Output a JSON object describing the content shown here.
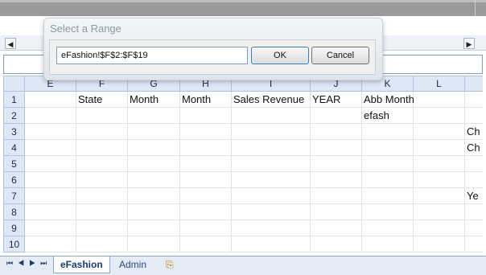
{
  "dialog": {
    "title": "Select a Range",
    "range_value": "eFashion!$F$2:$F$19",
    "ok_label": "OK",
    "cancel_label": "Cancel"
  },
  "grid": {
    "columns": [
      "E",
      "F",
      "G",
      "H",
      "I",
      "J",
      "K",
      "L"
    ],
    "rows": [
      {
        "num": "1",
        "cells": [
          "",
          "State",
          "Month",
          "Month",
          "Sales Revenue",
          "YEAR",
          "Abb Month",
          "",
          ""
        ]
      },
      {
        "num": "2",
        "cells": [
          "",
          "",
          "",
          "",
          "",
          "",
          "efash",
          "",
          ""
        ]
      },
      {
        "num": "3",
        "cells": [
          "",
          "",
          "",
          "",
          "",
          "",
          "",
          "",
          "Ch"
        ]
      },
      {
        "num": "4",
        "cells": [
          "",
          "",
          "",
          "",
          "",
          "",
          "",
          "",
          "Ch"
        ]
      },
      {
        "num": "5",
        "cells": [
          "",
          "",
          "",
          "",
          "",
          "",
          "",
          "",
          ""
        ]
      },
      {
        "num": "6",
        "cells": [
          "",
          "",
          "",
          "",
          "",
          "",
          "",
          "",
          ""
        ]
      },
      {
        "num": "7",
        "cells": [
          "",
          "",
          "",
          "",
          "",
          "",
          "",
          "",
          "Ye"
        ]
      },
      {
        "num": "8",
        "cells": [
          "",
          "",
          "",
          "",
          "",
          "",
          "",
          "",
          ""
        ]
      },
      {
        "num": "9",
        "cells": [
          "",
          "",
          "",
          "",
          "",
          "",
          "",
          "",
          ""
        ]
      },
      {
        "num": "10",
        "cells": [
          "",
          "",
          "",
          "",
          "",
          "",
          "",
          "",
          ""
        ]
      }
    ]
  },
  "sheet_tabs": {
    "active": "eFashion",
    "second": "Admin"
  },
  "icons": {
    "scroll_left": "chevron-left-icon",
    "scroll_right": "chevron-right-icon",
    "new_sheet": "insert-sheet-icon"
  },
  "colors": {
    "header_bg": "#dde8f6",
    "active_tab_text": "#183b72"
  }
}
